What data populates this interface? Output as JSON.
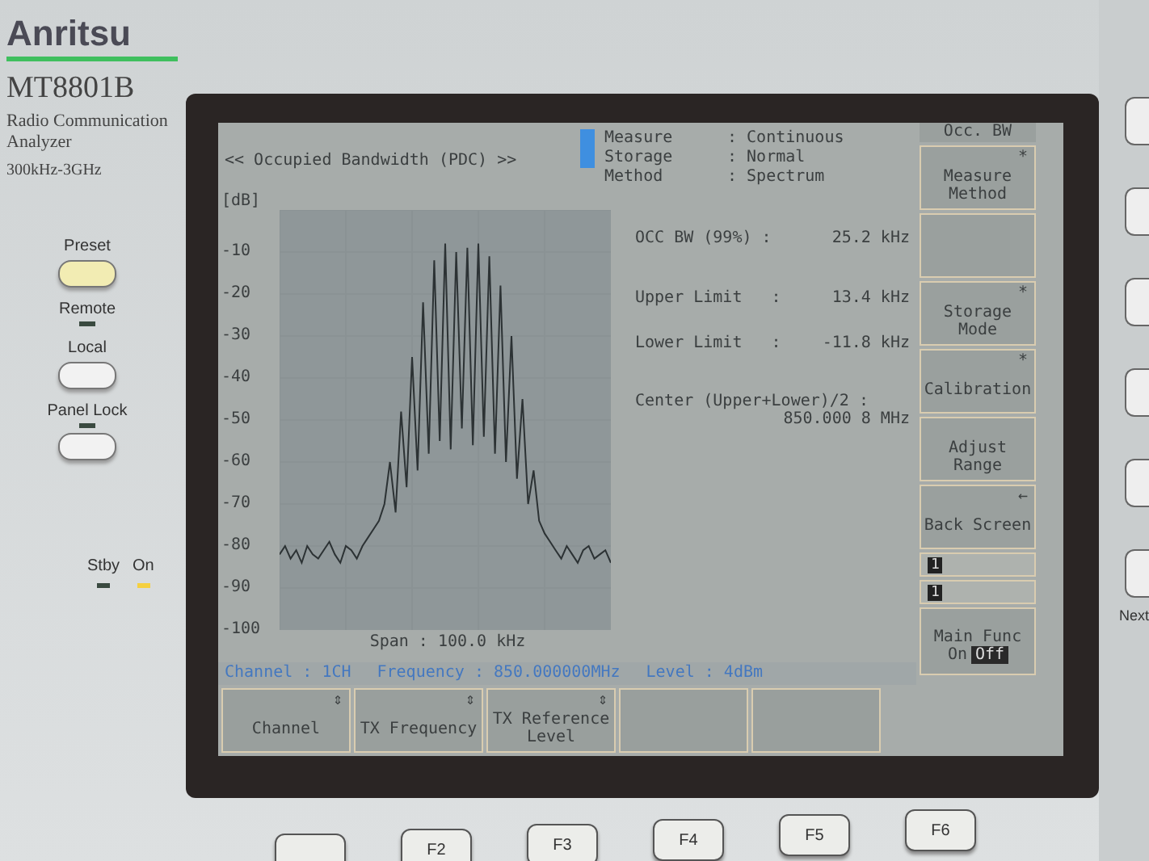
{
  "front_panel": {
    "brand": "Anritsu",
    "model": "MT8801B",
    "description": "Radio Communication Analyzer",
    "range": "300kHz-3GHz",
    "controls": [
      {
        "kind": "button",
        "label": "Preset",
        "lit": true
      },
      {
        "kind": "led",
        "label": "Remote",
        "on": false
      },
      {
        "kind": "button",
        "label": "Local",
        "lit": false
      },
      {
        "kind": "led",
        "label": "Panel Lock",
        "on": false
      },
      {
        "kind": "button",
        "lit": false
      }
    ],
    "power": [
      {
        "label": "Stby",
        "on": false
      },
      {
        "label": "On",
        "on": true
      }
    ]
  },
  "screen": {
    "title": "<< Occupied Bandwidth (PDC) >>",
    "settings": [
      {
        "name": "Measure",
        "value": ": Continuous"
      },
      {
        "name": "Storage",
        "value": ": Normal"
      },
      {
        "name": "Method",
        "value": ": Spectrum"
      }
    ],
    "chart_data": {
      "type": "line",
      "ylabel": "[dB]",
      "xlabel": "Span : 100.0 kHz",
      "ylim": [
        -100,
        0
      ],
      "yticks": [
        -10,
        -20,
        -30,
        -40,
        -50,
        -60,
        -70,
        -80,
        -90,
        -100
      ],
      "series": [
        {
          "color": "#2c3234",
          "values": [
            -82,
            -80,
            -83,
            -81,
            -84,
            -80,
            -82,
            -83,
            -81,
            -79,
            -82,
            -84,
            -80,
            -81,
            -83,
            -80,
            -78,
            -76,
            -74,
            -70,
            -60,
            -72,
            -48,
            -66,
            -35,
            -62,
            -22,
            -58,
            -12,
            -55,
            -8,
            -57,
            -10,
            -52,
            -9,
            -56,
            -8,
            -54,
            -11,
            -58,
            -18,
            -60,
            -30,
            -64,
            -45,
            -70,
            -62,
            -74,
            -77,
            -79,
            -81,
            -83,
            -80,
            -82,
            -84,
            -81,
            -80,
            -83,
            -82,
            -81,
            -84
          ]
        }
      ]
    },
    "results": [
      {
        "name": "OCC BW (99%) :",
        "value": "25.2 kHz"
      },
      {
        "name": "Upper Limit   :",
        "value": "13.4 kHz"
      },
      {
        "name": "Lower Limit   :",
        "value": "-11.8 kHz"
      }
    ],
    "center": {
      "name": "Center (Upper+Lower)/2 :",
      "value": "850.000 8 MHz"
    },
    "status": [
      {
        "name": "Channel :",
        "value": "1CH"
      },
      {
        "name": "Frequency :",
        "value": "850.000000MHz"
      },
      {
        "name": "Level :",
        "value": "4dBm"
      }
    ],
    "bottom_softkeys": [
      {
        "kind": "key",
        "label": "Channel",
        "mark": "⇕"
      },
      {
        "kind": "key",
        "label": "TX Frequency",
        "mark": "⇕"
      },
      {
        "kind": "key",
        "label": "TX Reference Level",
        "mark": "⇕"
      },
      {
        "kind": "blank"
      },
      {
        "kind": "blank"
      }
    ],
    "side_header": "Occ. BW",
    "side_softkeys": [
      {
        "kind": "key",
        "label": "Measure Method",
        "mark": "*"
      },
      {
        "kind": "key"
      },
      {
        "kind": "key",
        "label": "Storage Mode",
        "mark": "*"
      },
      {
        "kind": "key",
        "label": "Calibration",
        "mark": "*"
      },
      {
        "kind": "key",
        "label": "Adjust Range"
      },
      {
        "kind": "key",
        "label": "Back Screen",
        "mark": "←"
      },
      {
        "kind": "slot",
        "label": "1"
      },
      {
        "kind": "slot",
        "label": "1"
      }
    ],
    "main_func": {
      "label": "Main Func",
      "options": [
        {
          "label": "On",
          "selected": false
        },
        {
          "label": "Off",
          "selected": true
        }
      ]
    }
  },
  "function_keys": [
    {
      "kind": "key"
    },
    {
      "kind": "key",
      "label": "F2"
    },
    {
      "kind": "key",
      "label": "F3"
    },
    {
      "kind": "key",
      "label": "F4"
    },
    {
      "kind": "key",
      "label": "F5"
    },
    {
      "kind": "key",
      "label": "F6"
    }
  ],
  "right_panel": {
    "label": "Next"
  }
}
